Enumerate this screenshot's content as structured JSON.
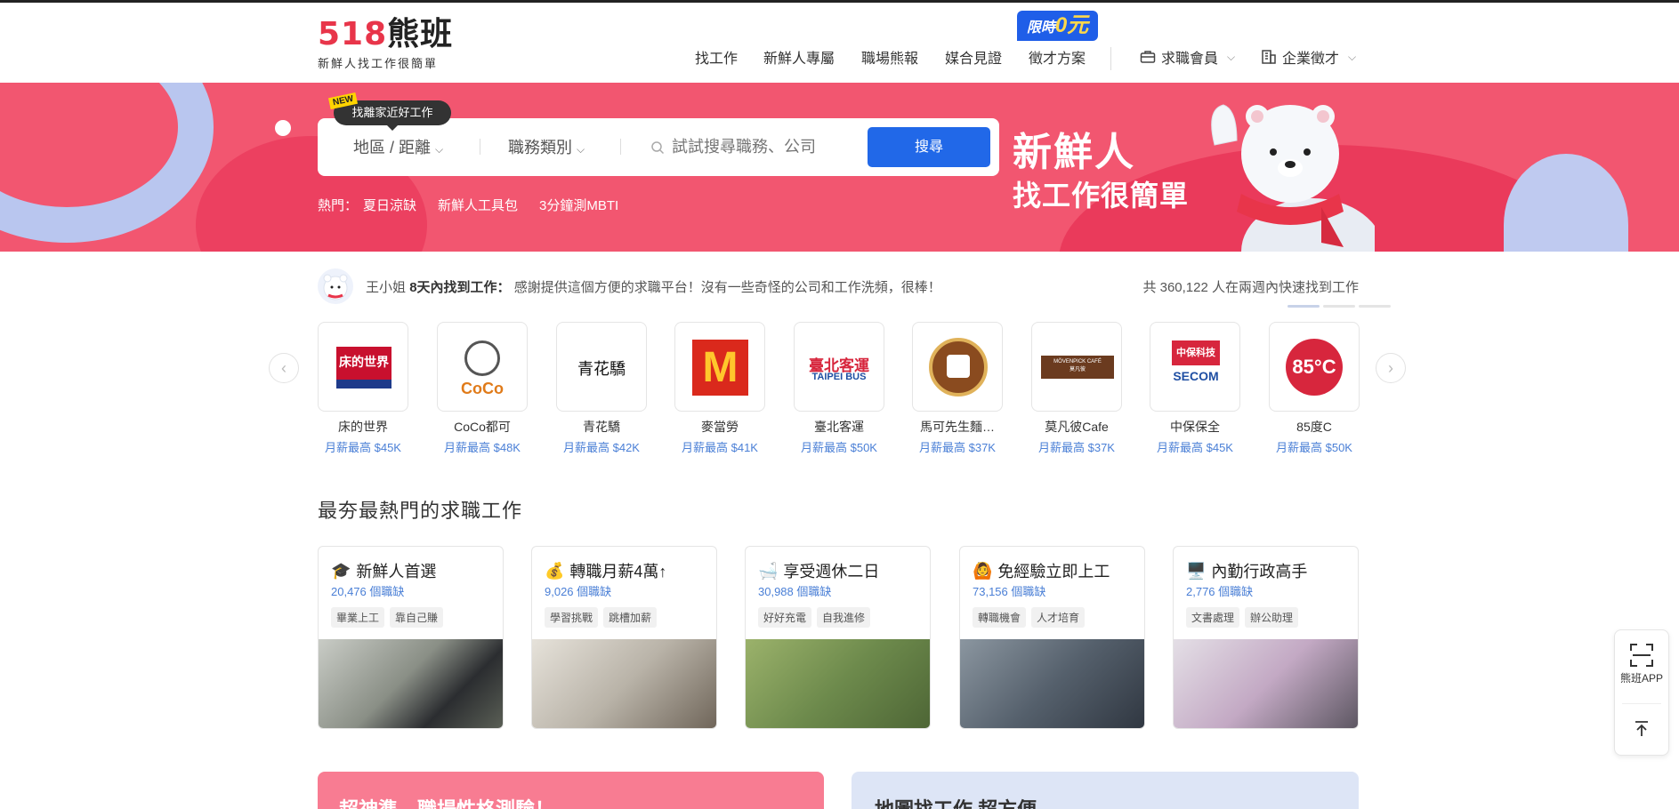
{
  "brand": {
    "logo_num": "518",
    "logo_name": "熊班",
    "tagline": "新鮮人找工作很簡單"
  },
  "nav": {
    "items": [
      "找工作",
      "新鮮人專屬",
      "職場熊報",
      "媒合見證",
      "徵才方案"
    ],
    "promo_text": "限時",
    "promo_zero": "0元",
    "member": "求職會員",
    "employer": "企業徵才"
  },
  "search": {
    "tip": "找離家近好工作",
    "new_tag": "NEW",
    "location": "地區 / 距離",
    "category": "職務類別",
    "placeholder": "試試搜尋職務、公司",
    "button": "搜尋",
    "hot_label": "熱門：",
    "hot": [
      "夏日涼缺",
      "新鮮人工具包",
      "3分鐘測MBTI"
    ]
  },
  "hero": {
    "line1": "新鮮人",
    "line2": "找工作很簡單"
  },
  "testimonial": {
    "name": "王小姐",
    "days": "8天內找到工作：",
    "quote": "感謝提供這個方便的求職平台！沒有一些奇怪的公司和工作洗頻，很棒！",
    "count_text": "共 360,122 人在兩週內快速找到工作"
  },
  "companies": [
    {
      "name": "床的世界",
      "salary": "月薪最高 $45K"
    },
    {
      "name": "CoCo都可",
      "salary": "月薪最高 $48K"
    },
    {
      "name": "青花驕",
      "salary": "月薪最高 $42K"
    },
    {
      "name": "麥當勞",
      "salary": "月薪最高 $41K"
    },
    {
      "name": "臺北客運",
      "salary": "月薪最高 $50K"
    },
    {
      "name": "馬可先生麵…",
      "salary": "月薪最高 $37K"
    },
    {
      "name": "莫凡彼Cafe",
      "salary": "月薪最高 $37K"
    },
    {
      "name": "中保保全",
      "salary": "月薪最高 $45K"
    },
    {
      "name": "85度C",
      "salary": "月薪最高 $50K"
    }
  ],
  "company_logo_text": {
    "bedworld": "床的世界",
    "coco": "CoCo",
    "qinghuajiao": "青花驕",
    "mcd": "M",
    "taipeibus_cn": "臺北客運",
    "taipeibus_en": "TAIPEI BUS",
    "movenpick_en": "MÖVENPICK CAFÉ",
    "movenpick_cn": "莫凡彼",
    "secom_cn": "中保科技",
    "secom_en": "SECOM",
    "c85": "85°C"
  },
  "section": {
    "title": "最夯最熱門的求職工作"
  },
  "categories": [
    {
      "emoji": "🎓",
      "title": "新鮮人首選",
      "count": "20,476 個職缺",
      "tags": [
        "畢業上工",
        "靠自己賺"
      ],
      "photo": "#8a8f86"
    },
    {
      "emoji": "💰",
      "title": "轉職月薪4萬↑",
      "count": "9,026 個職缺",
      "tags": [
        "學習挑戰",
        "跳槽加薪"
      ],
      "photo": "#b9b3a8"
    },
    {
      "emoji": "🛁",
      "title": "享受週休二日",
      "count": "30,988 個職缺",
      "tags": [
        "好好充電",
        "自我進修"
      ],
      "photo": "#6d8a4c"
    },
    {
      "emoji": "🙆",
      "title": "免經驗立即上工",
      "count": "73,156 個職缺",
      "tags": [
        "轉職機會",
        "人才培育"
      ],
      "photo": "#55606c"
    },
    {
      "emoji": "🖥️",
      "title": "內勤行政高手",
      "count": "2,776 個職缺",
      "tags": [
        "文書處理",
        "辦公助理"
      ],
      "photo": "#9a8ea0"
    }
  ],
  "bottom": {
    "left": "超神準，職場性格測驗！",
    "right": "地圖找工作 超方便"
  },
  "float": {
    "app": "熊班APP"
  }
}
